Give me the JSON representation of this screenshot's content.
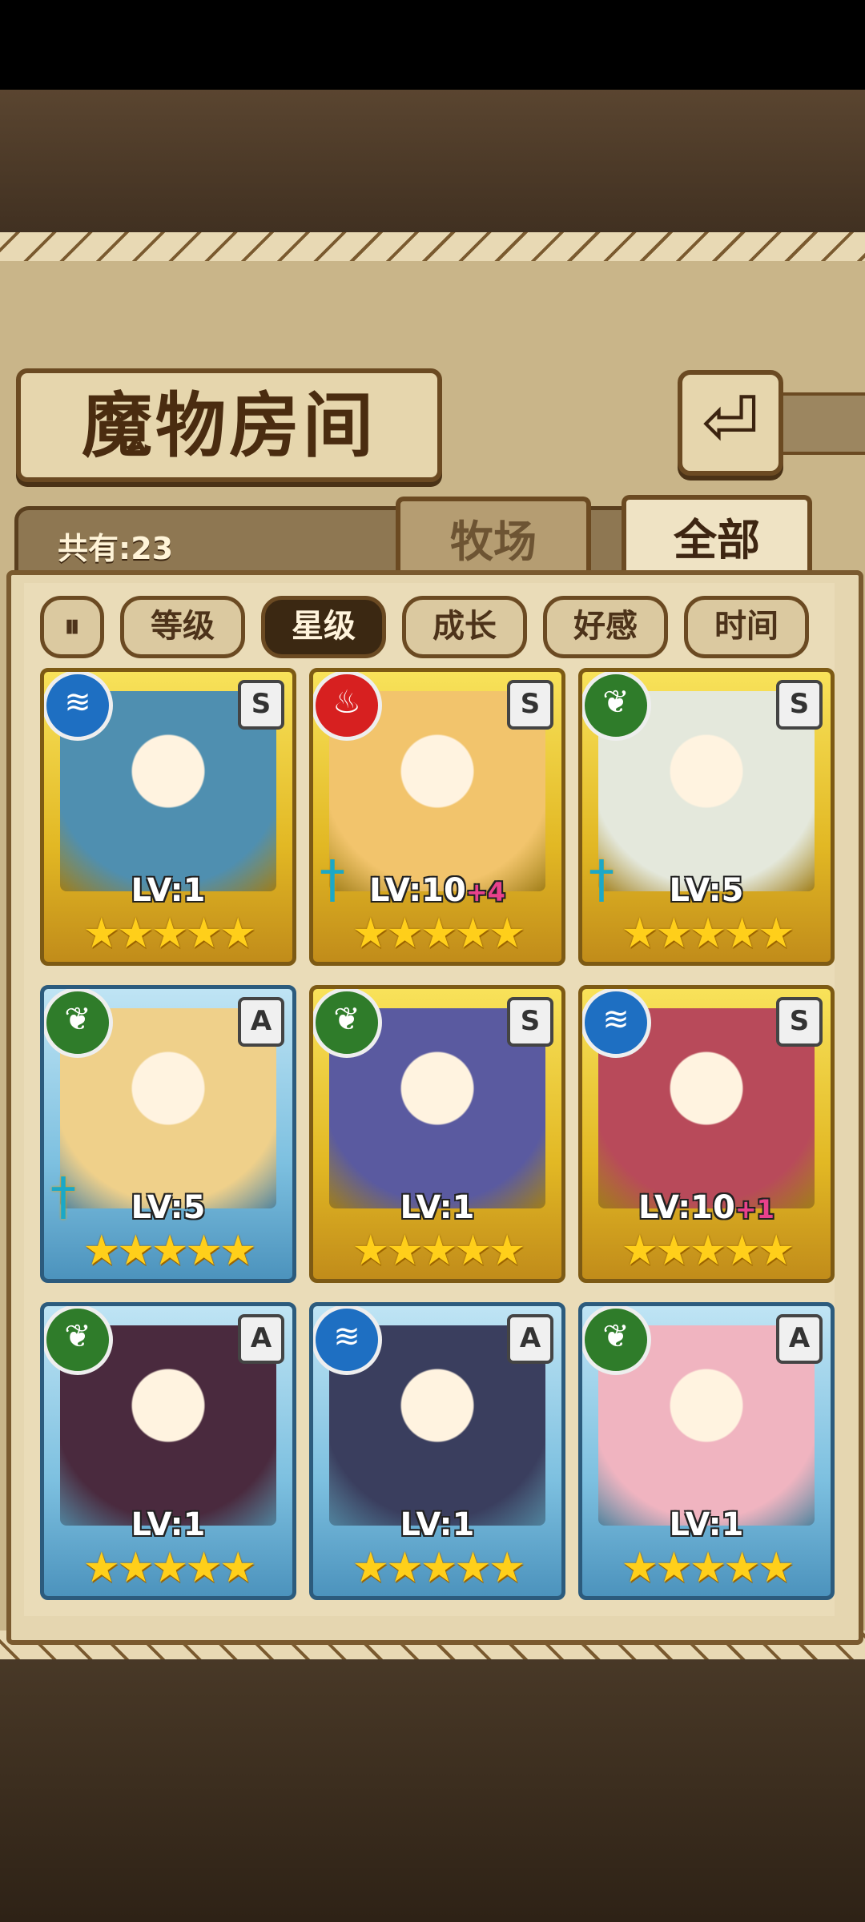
{
  "header": {
    "title": "魔物房间",
    "back_icon": "⏎"
  },
  "count": {
    "label": "共有:23"
  },
  "tabs": [
    {
      "label": "牧场",
      "active": false
    },
    {
      "label": "全部",
      "active": true
    }
  ],
  "sort": {
    "toggle_icon": "⏸",
    "buttons": [
      {
        "label": "等级",
        "active": false
      },
      {
        "label": "星级",
        "active": true
      },
      {
        "label": "成长",
        "active": false
      },
      {
        "label": "好感",
        "active": false
      },
      {
        "label": "时间",
        "active": false
      }
    ]
  },
  "colors": {
    "gold_frame": "#e2b824",
    "blue_frame": "#7dc0e0",
    "water": "#1e6fc2",
    "fire": "#d72020",
    "leaf": "#2f7c2a"
  },
  "cards": [
    {
      "element": "water",
      "rank": "S",
      "frame": "gold",
      "level": "LV:1",
      "bonus": "",
      "stars": "★★★★★",
      "equipped": false,
      "portrait": "#4f8fb0"
    },
    {
      "element": "fire",
      "rank": "S",
      "frame": "gold",
      "level": "LV:10",
      "bonus": "+4",
      "stars": "★★★★★",
      "equipped": true,
      "portrait": "#f2c46c"
    },
    {
      "element": "leaf",
      "rank": "S",
      "frame": "gold",
      "level": "LV:5",
      "bonus": "",
      "stars": "★★★★★",
      "equipped": true,
      "portrait": "#e4e8dc"
    },
    {
      "element": "leaf",
      "rank": "A",
      "frame": "blue",
      "level": "LV:5",
      "bonus": "",
      "stars": "★★★★★",
      "equipped": true,
      "portrait": "#efd08a"
    },
    {
      "element": "leaf",
      "rank": "S",
      "frame": "gold",
      "level": "LV:1",
      "bonus": "",
      "stars": "★★★★★",
      "equipped": false,
      "portrait": "#5a5aa0"
    },
    {
      "element": "water",
      "rank": "S",
      "frame": "gold",
      "level": "LV:10",
      "bonus": "+1",
      "stars": "★★★★★",
      "equipped": false,
      "portrait": "#b84a5a"
    },
    {
      "element": "leaf",
      "rank": "A",
      "frame": "blue",
      "level": "LV:1",
      "bonus": "",
      "stars": "★★★★★",
      "equipped": false,
      "portrait": "#4a2a3e"
    },
    {
      "element": "water",
      "rank": "A",
      "frame": "blue",
      "level": "LV:1",
      "bonus": "",
      "stars": "★★★★★",
      "equipped": false,
      "portrait": "#3a3e5e"
    },
    {
      "element": "leaf",
      "rank": "A",
      "frame": "blue",
      "level": "LV:1",
      "bonus": "",
      "stars": "★★★★★",
      "equipped": false,
      "portrait": "#f0b4c0"
    }
  ]
}
